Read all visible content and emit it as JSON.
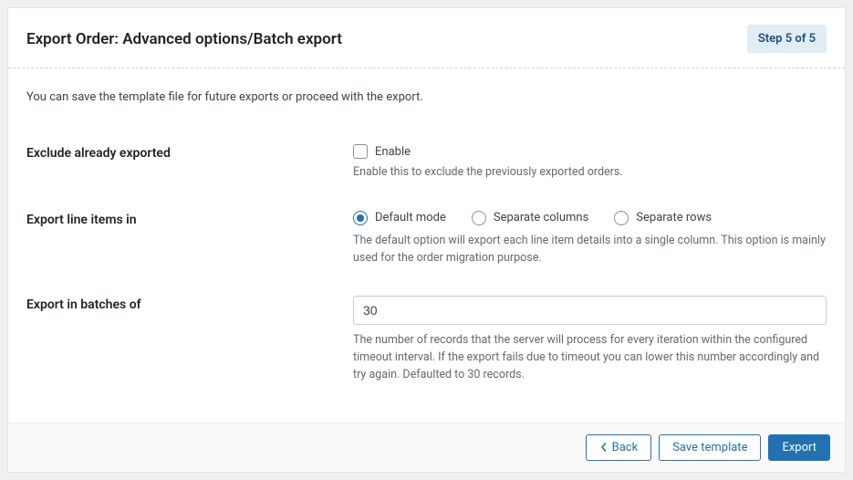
{
  "header": {
    "title": "Export Order: Advanced options/Batch export",
    "step_badge": "Step 5 of 5"
  },
  "intro": "You can save the template file for future exports or proceed with the export.",
  "exclude": {
    "label": "Exclude already exported",
    "checkbox_label": "Enable",
    "help": "Enable this to exclude the previously exported orders."
  },
  "line_items": {
    "label": "Export line items in",
    "options": [
      {
        "label": "Default mode",
        "selected": true
      },
      {
        "label": "Separate columns",
        "selected": false
      },
      {
        "label": "Separate rows",
        "selected": false
      }
    ],
    "help": "The default option will export each line item details into a single column. This option is mainly used for the order migration purpose."
  },
  "batch": {
    "label": "Export in batches of",
    "value": "30",
    "help": "The number of records that the server will process for every iteration within the configured timeout interval. If the export fails due to timeout you can lower this number accordingly and try again. Defaulted to 30 records."
  },
  "footer": {
    "back": "Back",
    "save_template": "Save template",
    "export": "Export"
  }
}
